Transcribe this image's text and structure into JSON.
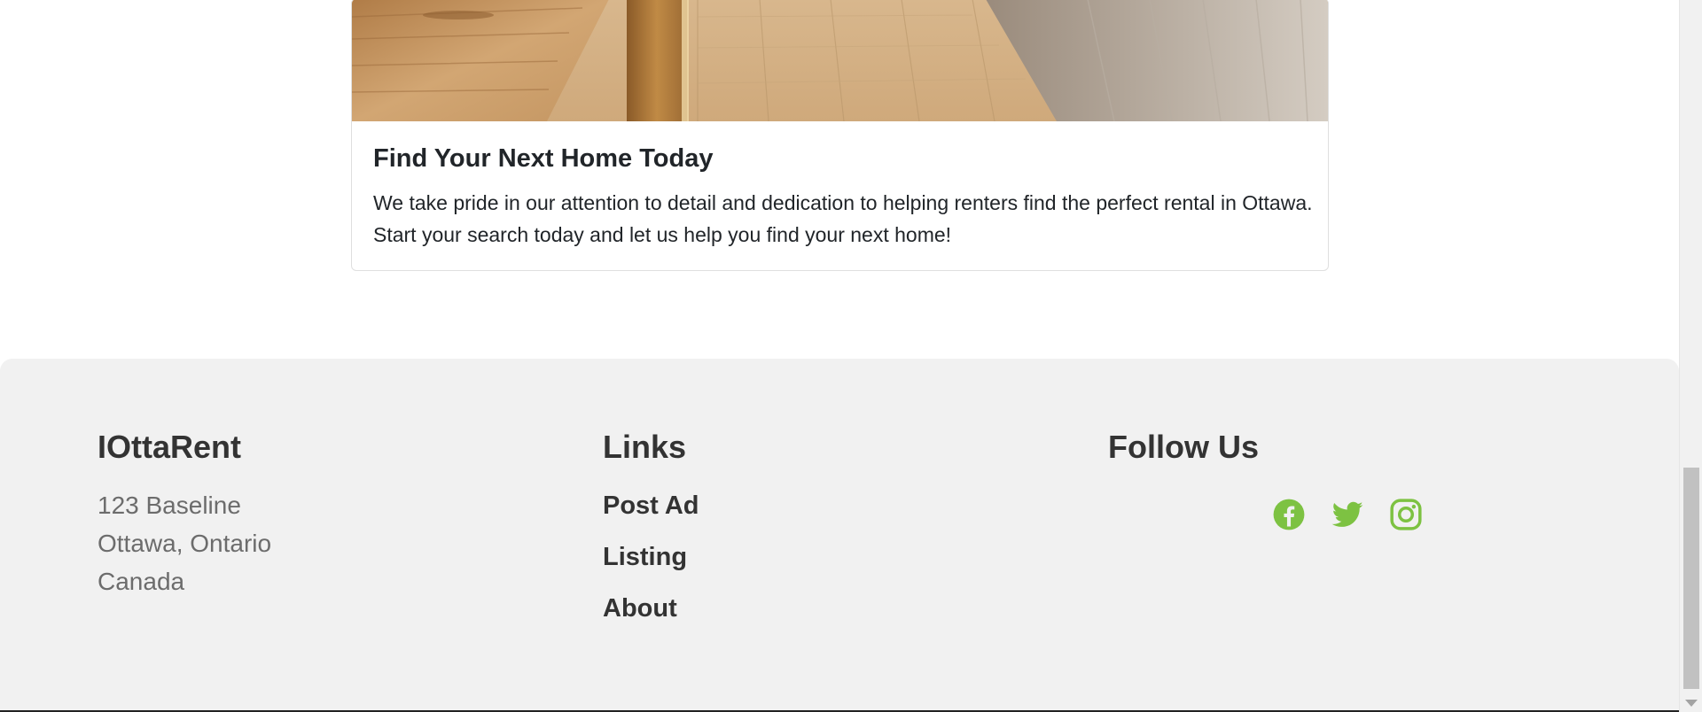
{
  "card": {
    "title": "Find Your Next Home Today",
    "text": "We take pride in our attention to detail and dedication to helping renters find the perfect rental in Ottawa. Start your search today and let us help you find your next home!"
  },
  "footer": {
    "brand": {
      "heading": "IOttaRent",
      "address": [
        "123 Baseline",
        "Ottawa, Ontario",
        "Canada"
      ]
    },
    "links": {
      "heading": "Links",
      "items": [
        "Post Ad",
        "Listing",
        "About"
      ]
    },
    "follow": {
      "heading": "Follow Us",
      "icons": [
        "facebook-icon",
        "twitter-icon",
        "instagram-icon"
      ]
    }
  },
  "colors": {
    "accent": "#7dc242",
    "footer_bg": "#f1f1f1",
    "text_dark": "#212529",
    "text_muted": "#6c6c6c"
  }
}
